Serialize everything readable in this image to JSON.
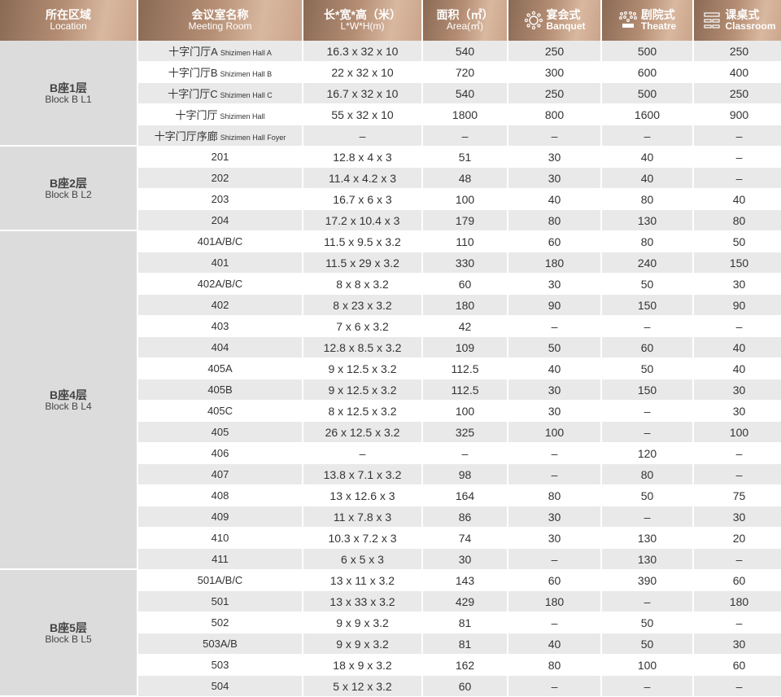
{
  "header": {
    "location": {
      "zh": "所在区域",
      "en": "Location"
    },
    "room": {
      "zh": "会议室名称",
      "en": "Meeting Room"
    },
    "dims": {
      "zh": "长*宽*高（米）",
      "en": "L*W*H(m)"
    },
    "area": {
      "zh": "面积（㎡）",
      "en": "Area(㎡)"
    },
    "banquet": {
      "zh": "宴会式",
      "en": "Banquet",
      "icon": "banquet-icon"
    },
    "theatre": {
      "zh": "剧院式",
      "en": "Theatre",
      "icon": "theatre-icon"
    },
    "classroom": {
      "zh": "课桌式",
      "en": "Classroom",
      "icon": "classroom-icon"
    }
  },
  "groups": [
    {
      "zh": "B座1层",
      "en": "Block B L1",
      "rows": [
        {
          "name_zh": "十字门厅A",
          "name_en": "Shizimen Hall A",
          "dims": "16.3 x 32 x 10",
          "area": "540",
          "banquet": "250",
          "theatre": "500",
          "classroom": "250"
        },
        {
          "name_zh": "十字门厅B",
          "name_en": "Shizimen Hall B",
          "dims": "22 x 32 x 10",
          "area": "720",
          "banquet": "300",
          "theatre": "600",
          "classroom": "400"
        },
        {
          "name_zh": "十字门厅C",
          "name_en": "Shizimen Hall C",
          "dims": "16.7 x 32 x 10",
          "area": "540",
          "banquet": "250",
          "theatre": "500",
          "classroom": "250"
        },
        {
          "name_zh": "十字门厅",
          "name_en": "Shizimen Hall",
          "dims": "55 x 32 x 10",
          "area": "1800",
          "banquet": "800",
          "theatre": "1600",
          "classroom": "900"
        },
        {
          "name_zh": "十字门厅序廊",
          "name_en": "Shizimen Hall Foyer",
          "dims": "–",
          "area": "–",
          "banquet": "–",
          "theatre": "–",
          "classroom": "–"
        }
      ]
    },
    {
      "zh": "B座2层",
      "en": "Block B L2",
      "rows": [
        {
          "name_zh": "201",
          "name_en": "",
          "dims": "12.8 x 4 x 3",
          "area": "51",
          "banquet": "30",
          "theatre": "40",
          "classroom": "–"
        },
        {
          "name_zh": "202",
          "name_en": "",
          "dims": "11.4 x 4.2 x 3",
          "area": "48",
          "banquet": "30",
          "theatre": "40",
          "classroom": "–"
        },
        {
          "name_zh": "203",
          "name_en": "",
          "dims": "16.7 x 6 x 3",
          "area": "100",
          "banquet": "40",
          "theatre": "80",
          "classroom": "40"
        },
        {
          "name_zh": "204",
          "name_en": "",
          "dims": "17.2 x 10.4 x 3",
          "area": "179",
          "banquet": "80",
          "theatre": "130",
          "classroom": "80"
        }
      ]
    },
    {
      "zh": "B座4层",
      "en": "Block B L4",
      "rows": [
        {
          "name_zh": "401A/B/C",
          "name_en": "",
          "dims": "11.5 x 9.5 x 3.2",
          "area": "110",
          "banquet": "60",
          "theatre": "80",
          "classroom": "50"
        },
        {
          "name_zh": "401",
          "name_en": "",
          "dims": "11.5 x 29 x 3.2",
          "area": "330",
          "banquet": "180",
          "theatre": "240",
          "classroom": "150"
        },
        {
          "name_zh": "402A/B/C",
          "name_en": "",
          "dims": "8 x 8 x 3.2",
          "area": "60",
          "banquet": "30",
          "theatre": "50",
          "classroom": "30"
        },
        {
          "name_zh": "402",
          "name_en": "",
          "dims": "8 x 23 x 3.2",
          "area": "180",
          "banquet": "90",
          "theatre": "150",
          "classroom": "90"
        },
        {
          "name_zh": "403",
          "name_en": "",
          "dims": "7 x 6 x 3.2",
          "area": "42",
          "banquet": "–",
          "theatre": "–",
          "classroom": "–"
        },
        {
          "name_zh": "404",
          "name_en": "",
          "dims": "12.8 x 8.5 x 3.2",
          "area": "109",
          "banquet": "50",
          "theatre": "60",
          "classroom": "40"
        },
        {
          "name_zh": "405A",
          "name_en": "",
          "dims": "9 x 12.5 x 3.2",
          "area": "112.5",
          "banquet": "40",
          "theatre": "50",
          "classroom": "40"
        },
        {
          "name_zh": "405B",
          "name_en": "",
          "dims": "9 x 12.5 x 3.2",
          "area": "112.5",
          "banquet": "30",
          "theatre": "150",
          "classroom": "30"
        },
        {
          "name_zh": "405C",
          "name_en": "",
          "dims": "8 x 12.5 x 3.2",
          "area": "100",
          "banquet": "30",
          "theatre": "–",
          "classroom": "30"
        },
        {
          "name_zh": "405",
          "name_en": "",
          "dims": "26 x 12.5 x 3.2",
          "area": "325",
          "banquet": "100",
          "theatre": "–",
          "classroom": "100"
        },
        {
          "name_zh": "406",
          "name_en": "",
          "dims": "–",
          "area": "–",
          "banquet": "–",
          "theatre": "120",
          "classroom": "–"
        },
        {
          "name_zh": "407",
          "name_en": "",
          "dims": "13.8 x 7.1 x 3.2",
          "area": "98",
          "banquet": "–",
          "theatre": "80",
          "classroom": "–"
        },
        {
          "name_zh": "408",
          "name_en": "",
          "dims": "13 x 12.6 x 3",
          "area": "164",
          "banquet": "80",
          "theatre": "50",
          "classroom": "75"
        },
        {
          "name_zh": "409",
          "name_en": "",
          "dims": "11 x 7.8 x 3",
          "area": "86",
          "banquet": "30",
          "theatre": "–",
          "classroom": "30"
        },
        {
          "name_zh": "410",
          "name_en": "",
          "dims": "10.3 x 7.2 x 3",
          "area": "74",
          "banquet": "30",
          "theatre": "130",
          "classroom": "20"
        },
        {
          "name_zh": "411",
          "name_en": "",
          "dims": "6 x 5 x 3",
          "area": "30",
          "banquet": "–",
          "theatre": "130",
          "classroom": "–"
        }
      ]
    },
    {
      "zh": "B座5层",
      "en": "Block B L5",
      "rows": [
        {
          "name_zh": "501A/B/C",
          "name_en": "",
          "dims": "13 x 11 x 3.2",
          "area": "143",
          "banquet": "60",
          "theatre": "390",
          "classroom": "60"
        },
        {
          "name_zh": "501",
          "name_en": "",
          "dims": "13 x 33 x 3.2",
          "area": "429",
          "banquet": "180",
          "theatre": "–",
          "classroom": "180"
        },
        {
          "name_zh": "502",
          "name_en": "",
          "dims": "9 x 9 x 3.2",
          "area": "81",
          "banquet": "–",
          "theatre": "50",
          "classroom": "–"
        },
        {
          "name_zh": "503A/B",
          "name_en": "",
          "dims": "9 x 9 x 3.2",
          "area": "81",
          "banquet": "40",
          "theatre": "50",
          "classroom": "30"
        },
        {
          "name_zh": "503",
          "name_en": "",
          "dims": "18 x 9 x 3.2",
          "area": "162",
          "banquet": "80",
          "theatre": "100",
          "classroom": "60"
        },
        {
          "name_zh": "504",
          "name_en": "",
          "dims": "5 x 12 x 3.2",
          "area": "60",
          "banquet": "–",
          "theatre": "–",
          "classroom": "–"
        }
      ]
    }
  ]
}
